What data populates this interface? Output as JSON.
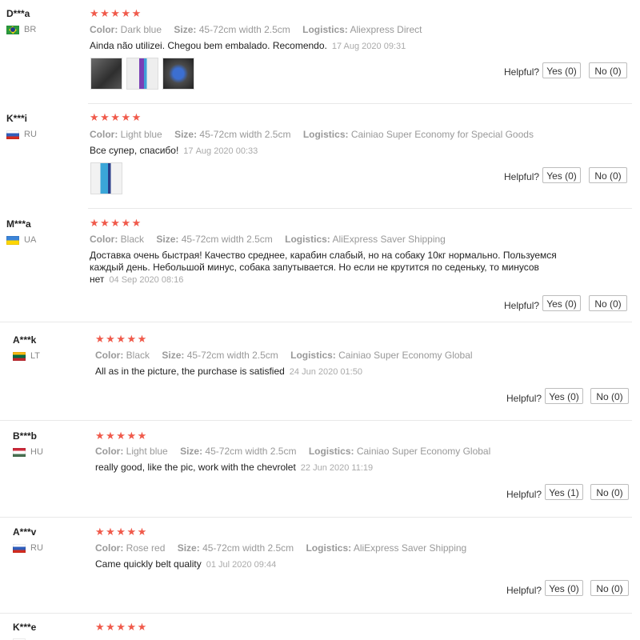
{
  "labels": {
    "color": "Color:",
    "size": "Size:",
    "logistics": "Logistics:",
    "helpful": "Helpful?"
  },
  "colors": {
    "star": "#f05a4b",
    "muted": "#999999",
    "divider": "#e8e8e8"
  },
  "reviews": [
    {
      "user": "D***a",
      "country": "BR",
      "flag": "br",
      "rating": 5,
      "stars": "★★★★★",
      "color": "Dark blue",
      "size": "45-72cm width 2.5cm",
      "logistics": "Aliexpress Direct",
      "text": "Ainda não utilizei. Chegou bem embalado. Recomendo.",
      "date": "17 Aug 2020 09:31",
      "yes": "Yes (0)",
      "no": "No (0)"
    },
    {
      "user": "K***i",
      "country": "RU",
      "flag": "ru",
      "rating": 5,
      "stars": "★★★★★",
      "color": "Light blue",
      "size": "45-72cm width 2.5cm",
      "logistics": "Cainiao Super Economy for Special Goods",
      "text": "Все супер, спасибо!",
      "date": "17 Aug 2020 00:33",
      "yes": "Yes (0)",
      "no": "No (0)"
    },
    {
      "user": "M***a",
      "country": "UA",
      "flag": "ua",
      "rating": 5,
      "stars": "★★★★★",
      "color": "Black",
      "size": "45-72cm width 2.5cm",
      "logistics": "AliExpress Saver Shipping",
      "text": "Доставка очень быстрая! Качество среднее, карабин слабый, но на собаку 10кг нормально. Пользуемся каждый день. Небольшой минус, собака запутывается. Но если не крутится по седеньку, то минусов нет",
      "date": "04 Sep 2020 08:16",
      "yes": "Yes (0)",
      "no": "No (0)"
    },
    {
      "user": "A***k",
      "country": "LT",
      "flag": "lt",
      "rating": 5,
      "stars": "★★★★★",
      "color": "Black",
      "size": "45-72cm width 2.5cm",
      "logistics": "Cainiao Super Economy Global",
      "text": "All as in the picture, the purchase is satisfied",
      "date": "24 Jun 2020 01:50",
      "yes": "Yes (0)",
      "no": "No (0)"
    },
    {
      "user": "B***b",
      "country": "HU",
      "flag": "hu",
      "rating": 5,
      "stars": "★★★★★",
      "color": "Light blue",
      "size": "45-72cm width 2.5cm",
      "logistics": "Cainiao Super Economy Global",
      "text": "really good, like the pic, work with the chevrolet",
      "date": "22 Jun 2020 11:19",
      "yes": "Yes (1)",
      "no": "No (0)"
    },
    {
      "user": "A***v",
      "country": "RU",
      "flag": "ru",
      "rating": 5,
      "stars": "★★★★★",
      "color": "Rose red",
      "size": "45-72cm width 2.5cm",
      "logistics": "AliExpress Saver Shipping",
      "text": "Came quickly belt quality",
      "date": "01 Jul 2020 09:44",
      "yes": "Yes (0)",
      "no": "No (0)"
    },
    {
      "user": "K***e",
      "country": "",
      "flag": "ru",
      "rating": 5,
      "stars": "★★★★★"
    }
  ]
}
